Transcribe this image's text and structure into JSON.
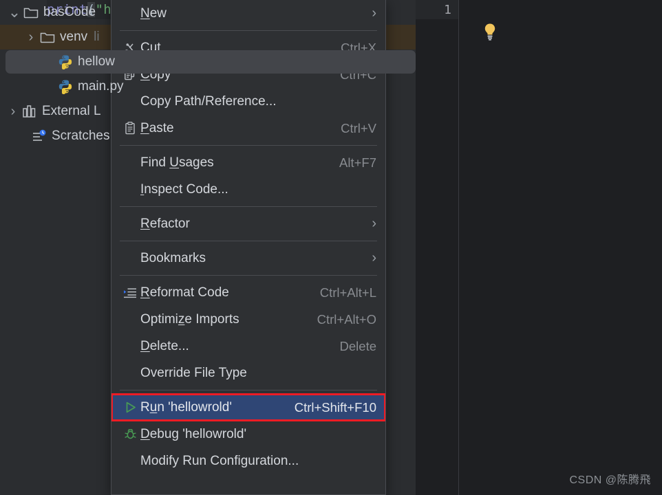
{
  "project_tree": {
    "rows": [
      {
        "label": "basCode",
        "sub": "",
        "icon": "folder-icon",
        "arrow": "expanded",
        "state": "normal"
      },
      {
        "label": "venv",
        "sub": "li",
        "icon": "folder-icon",
        "arrow": "collapsed",
        "state": "library-root"
      },
      {
        "label": "hellow",
        "sub": "",
        "icon": "python-file-icon",
        "arrow": "none",
        "state": "selected"
      },
      {
        "label": "main.py",
        "sub": "",
        "icon": "python-file-icon",
        "arrow": "none",
        "state": "normal"
      },
      {
        "label": "External L",
        "sub": "",
        "icon": "library-icon",
        "arrow": "collapsed",
        "state": "normal"
      },
      {
        "label": "Scratches",
        "sub": "",
        "icon": "scratches-icon",
        "arrow": "none",
        "state": "normal"
      }
    ]
  },
  "editor": {
    "line_number": "1",
    "code": {
      "fn": "print",
      "open_paren": "(",
      "string": "\"hello world\"",
      "close_paren": ")"
    },
    "hint_icon": "lightbulb-icon"
  },
  "context_menu": {
    "items": [
      {
        "type": "item",
        "label": "New",
        "mnemonic": "N",
        "accel": "",
        "icon": "",
        "submenu": true
      },
      {
        "type": "separator"
      },
      {
        "type": "item",
        "label": "Cut",
        "mnemonic": "t",
        "accel": "Ctrl+X",
        "icon": "scissors-icon",
        "submenu": false
      },
      {
        "type": "item",
        "label": "Copy",
        "mnemonic": "C",
        "accel": "Ctrl+C",
        "icon": "copy-icon",
        "submenu": false
      },
      {
        "type": "item",
        "label": "Copy Path/Reference...",
        "mnemonic": "",
        "accel": "",
        "icon": "",
        "submenu": false
      },
      {
        "type": "item",
        "label": "Paste",
        "mnemonic": "P",
        "accel": "Ctrl+V",
        "icon": "clipboard-icon",
        "submenu": false
      },
      {
        "type": "separator"
      },
      {
        "type": "item",
        "label": "Find Usages",
        "mnemonic": "U",
        "accel": "Alt+F7",
        "icon": "",
        "submenu": false
      },
      {
        "type": "item",
        "label": "Inspect Code...",
        "mnemonic": "I",
        "accel": "",
        "icon": "",
        "submenu": false
      },
      {
        "type": "separator"
      },
      {
        "type": "item",
        "label": "Refactor",
        "mnemonic": "R",
        "accel": "",
        "icon": "",
        "submenu": true
      },
      {
        "type": "separator"
      },
      {
        "type": "item",
        "label": "Bookmarks",
        "mnemonic": "",
        "accel": "",
        "icon": "",
        "submenu": true
      },
      {
        "type": "separator"
      },
      {
        "type": "item",
        "label": "Reformat Code",
        "mnemonic": "R",
        "accel": "Ctrl+Alt+L",
        "icon": "reformat-icon",
        "submenu": false
      },
      {
        "type": "item",
        "label": "Optimize Imports",
        "mnemonic": "z",
        "accel": "Ctrl+Alt+O",
        "icon": "",
        "submenu": false
      },
      {
        "type": "item",
        "label": "Delete...",
        "mnemonic": "D",
        "accel": "Delete",
        "icon": "",
        "submenu": false
      },
      {
        "type": "item",
        "label": "Override File Type",
        "mnemonic": "",
        "accel": "",
        "icon": "",
        "submenu": false
      },
      {
        "type": "separator"
      },
      {
        "type": "item",
        "label": "Run 'hellowrold'",
        "mnemonic": "u",
        "accel": "Ctrl+Shift+F10",
        "icon": "run-icon",
        "submenu": false,
        "selected": true
      },
      {
        "type": "item",
        "label": "Debug 'hellowrold'",
        "mnemonic": "D",
        "accel": "",
        "icon": "debug-icon",
        "submenu": false
      },
      {
        "type": "item",
        "label": "Modify Run Configuration...",
        "mnemonic": "",
        "accel": "",
        "icon": "",
        "submenu": false
      }
    ]
  },
  "watermark": {
    "text": "CSDN @陈腾飛"
  },
  "colors": {
    "menu_bg": "#2e3033",
    "panel_bg": "#2b2d30",
    "editor_bg": "#1e1f22",
    "selection_blue": "#2f4675",
    "highlight_red": "#ee1c24",
    "library_root": "#3d3222",
    "string_green": "#6aab73",
    "keyword_violet": "#8888c6"
  }
}
